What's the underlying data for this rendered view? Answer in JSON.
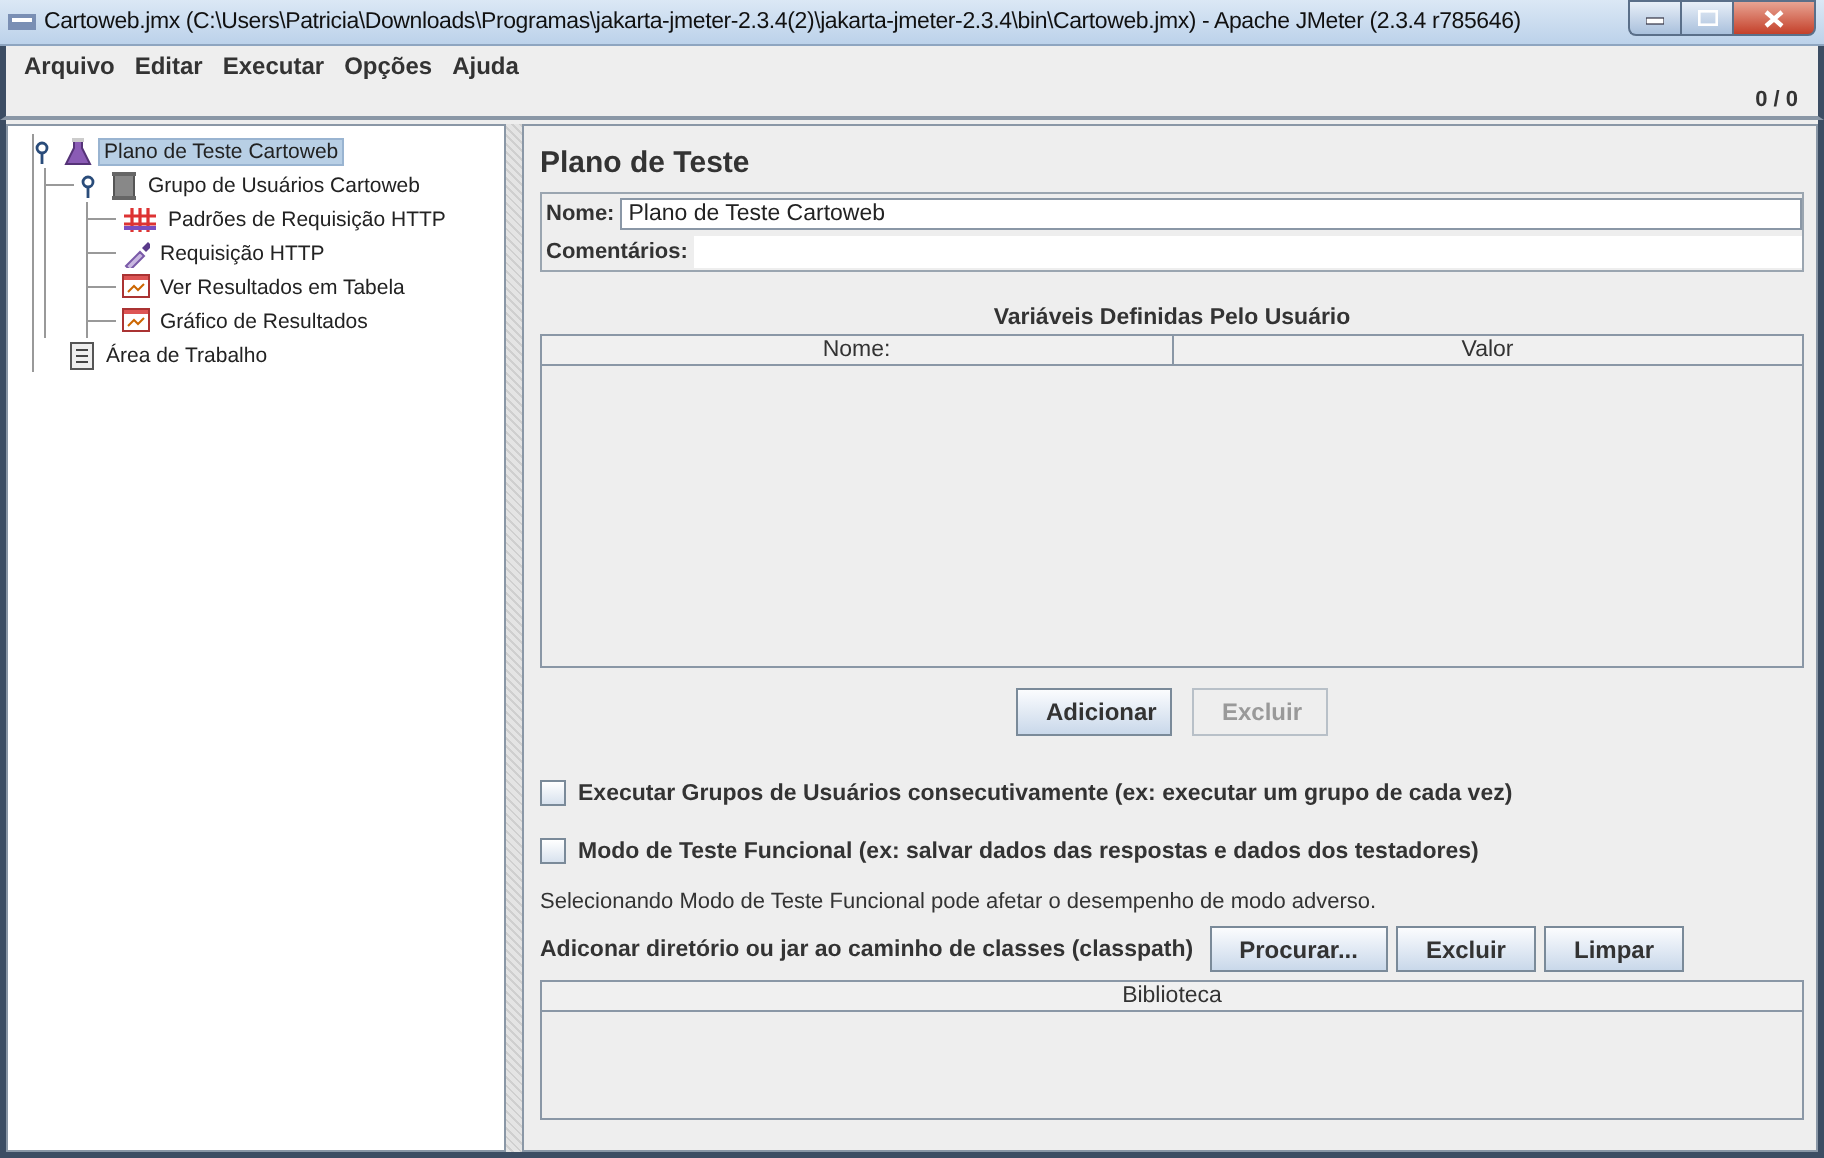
{
  "window": {
    "title": "Cartoweb.jmx (C:\\Users\\Patricia\\Downloads\\Programas\\jakarta-jmeter-2.3.4(2)\\jakarta-jmeter-2.3.4\\bin\\Cartoweb.jmx) - Apache JMeter (2.3.4 r785646)"
  },
  "menu": [
    {
      "label": "Arquivo"
    },
    {
      "label": "Editar"
    },
    {
      "label": "Executar"
    },
    {
      "label": "Opções"
    },
    {
      "label": "Ajuda"
    }
  ],
  "toolbar": {
    "counter": "0 / 0"
  },
  "tree": [
    {
      "label": "Plano de Teste Cartoweb",
      "kind": "plan",
      "selected": true,
      "expanded": true,
      "children": [
        {
          "label": "Grupo de Usuários Cartoweb",
          "kind": "thread-group",
          "selected": false,
          "expanded": true,
          "children": [
            {
              "label": "Padrões de Requisição HTTP",
              "kind": "config",
              "selected": false
            },
            {
              "label": "Requisição HTTP",
              "kind": "sampler",
              "selected": false
            },
            {
              "label": "Ver Resultados em Tabela",
              "kind": "listener",
              "selected": false
            },
            {
              "label": "Gráfico de Resultados",
              "kind": "listener",
              "selected": false
            }
          ]
        }
      ]
    },
    {
      "label": "Área de Trabalho",
      "kind": "workbench",
      "selected": false
    }
  ],
  "panel": {
    "title": "Plano de Teste",
    "name_field": {
      "label": "Nome:",
      "value": "Plano de Teste Cartoweb"
    },
    "comments_field": {
      "label": "Comentários:"
    },
    "variables_table": {
      "title": "Variáveis Definidas Pelo Usuário",
      "columns": [
        "Nome:",
        "Valor"
      ]
    },
    "table_buttons": [
      {
        "label": "Adicionar",
        "disabled": false
      },
      {
        "label": "Excluir",
        "disabled": true
      }
    ],
    "checkboxes": [
      {
        "label": "Executar Grupos de Usuários consecutivamente (ex: executar um grupo de cada vez)",
        "checked": false
      },
      {
        "label": "Modo de Teste Funcional (ex: salvar dados das respostas e dados dos testadores)",
        "checked": false
      }
    ],
    "note": "Selecionando Modo de Teste Funcional pode afetar o desempenho de modo adverso.",
    "classpath": {
      "label": "Adiconar diretório ou jar ao caminho de classes (classpath)",
      "buttons": [
        {
          "label": "Procurar...",
          "disabled": false
        },
        {
          "label": "Excluir",
          "disabled": false
        },
        {
          "label": "Limpar",
          "disabled": false
        }
      ]
    },
    "library_table": {
      "columns": [
        "Biblioteca"
      ]
    }
  }
}
